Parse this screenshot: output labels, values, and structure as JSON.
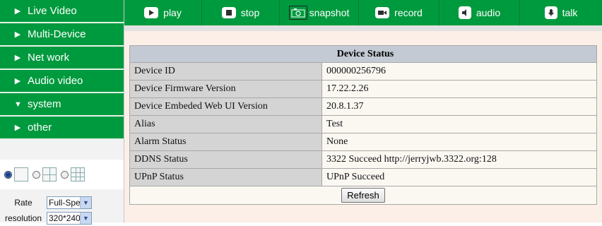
{
  "sidebar": {
    "items": [
      {
        "label": "Live Video",
        "arrow": "▶"
      },
      {
        "label": "Multi-Device",
        "arrow": "▶"
      },
      {
        "label": "Net work",
        "arrow": "▶"
      },
      {
        "label": "Audio video",
        "arrow": "▶"
      },
      {
        "label": "system",
        "arrow": "▼"
      },
      {
        "label": "other",
        "arrow": "▶"
      }
    ],
    "rate_label": "Rate",
    "rate_value": "Full-Speed",
    "resolution_label": "resolution",
    "resolution_value": "320*240"
  },
  "toolbar": {
    "play": "play",
    "stop": "stop",
    "snapshot": "snapshot",
    "record": "record",
    "audio": "audio",
    "talk": "talk"
  },
  "device_status": {
    "title": "Device Status",
    "rows": [
      {
        "key": "Device ID",
        "value": "000000256796"
      },
      {
        "key": "Device Firmware Version",
        "value": "17.22.2.26"
      },
      {
        "key": "Device Embeded Web UI Version",
        "value": "20.8.1.37"
      },
      {
        "key": "Alias",
        "value": "Test"
      },
      {
        "key": "Alarm Status",
        "value": "None"
      },
      {
        "key": "DDNS Status",
        "value": "3322 Succeed  http://jerryjwb.3322.org:128"
      },
      {
        "key": "UPnP Status",
        "value": "UPnP Succeed"
      }
    ],
    "refresh_label": "Refresh"
  },
  "colors": {
    "nav_green": "#009a3e",
    "header_gray": "#c3cad4",
    "panel_bg": "#fcefe8"
  }
}
